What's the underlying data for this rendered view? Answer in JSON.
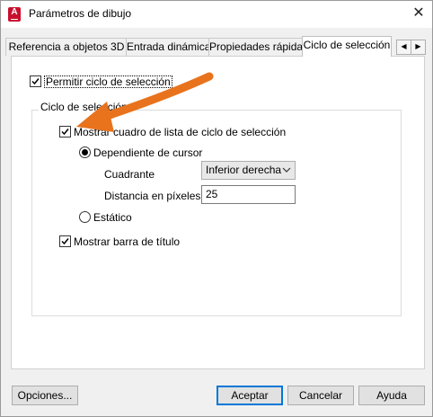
{
  "window": {
    "title": "Parámetros de dibujo",
    "close_glyph": "✕"
  },
  "app_icon": {
    "letter": "A"
  },
  "tabs": [
    {
      "label": "Referencia a objetos 3D"
    },
    {
      "label": "Entrada dinámica"
    },
    {
      "label": "Propiedades rápidas"
    },
    {
      "label": "Ciclo de selección",
      "active": true
    }
  ],
  "tab_scroll": {
    "left": "◀",
    "right": "▶"
  },
  "panel": {
    "allow_cycling": {
      "label": "Permitir ciclo de selección",
      "checked": true
    },
    "group": {
      "legend": "Ciclo de selección",
      "show_list_box": {
        "label": "Mostrar cuadro de lista de ciclo de selección",
        "checked": true
      },
      "cursor_dependent": {
        "label": "Dependiente de cursor",
        "selected": true
      },
      "quadrant": {
        "label": "Cuadrante",
        "value": "Inferior derecha"
      },
      "distance": {
        "label": "Distancia en píxeles",
        "value": "25"
      },
      "static": {
        "label": "Estático",
        "selected": false
      },
      "show_title_bar": {
        "label": "Mostrar barra de título",
        "checked": true
      }
    }
  },
  "buttons": {
    "options": "Opciones...",
    "accept": "Aceptar",
    "cancel": "Cancelar",
    "help": "Ayuda"
  },
  "colors": {
    "annotation_arrow": "#e8731c",
    "app_icon": "#c8102e",
    "focus": "#0078d7"
  }
}
